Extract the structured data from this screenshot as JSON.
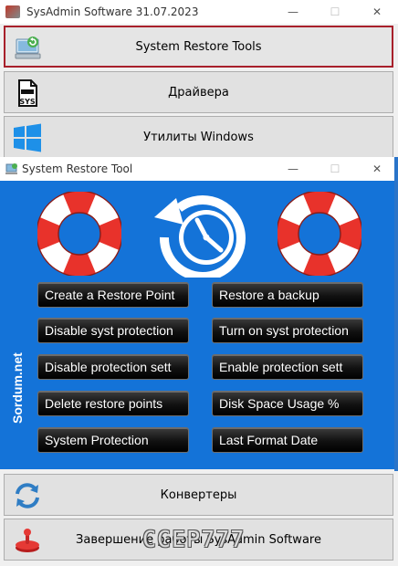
{
  "outer_window": {
    "title": "SysAdmin Software 31.07.2023",
    "controls": {
      "minimize": "—",
      "maximize": "☐",
      "close": "✕"
    },
    "menu": [
      {
        "label": "System Restore Tools",
        "icon": "computer-restore-icon"
      },
      {
        "label": "Драйвера",
        "icon": "sys-file-icon"
      },
      {
        "label": "Утилиты Windows",
        "icon": "windows-logo-icon"
      },
      {
        "label": "Конвертеры",
        "icon": "refresh-arrows-icon"
      },
      {
        "label": "Завершение работы SysAdmin Software",
        "icon": "power-off-icon"
      }
    ]
  },
  "inner_window": {
    "title": "System Restore Tool",
    "controls": {
      "minimize": "—",
      "maximize": "☐",
      "close": "✕"
    },
    "side_label": "Sordum.net",
    "buttons": [
      "Create a Restore Point",
      "Restore a backup",
      "Disable syst protection",
      "Turn on syst protection",
      "Disable protection sett",
      "Enable protection sett",
      "Delete restore points",
      "Disk Space Usage %",
      "System Protection",
      "Last Format Date"
    ]
  },
  "watermark": "CCEP777",
  "colors": {
    "panel_blue": "#1473d8",
    "active_border": "#a8202b",
    "lifebuoy_red": "#e8322b",
    "button_black": "#111111"
  }
}
